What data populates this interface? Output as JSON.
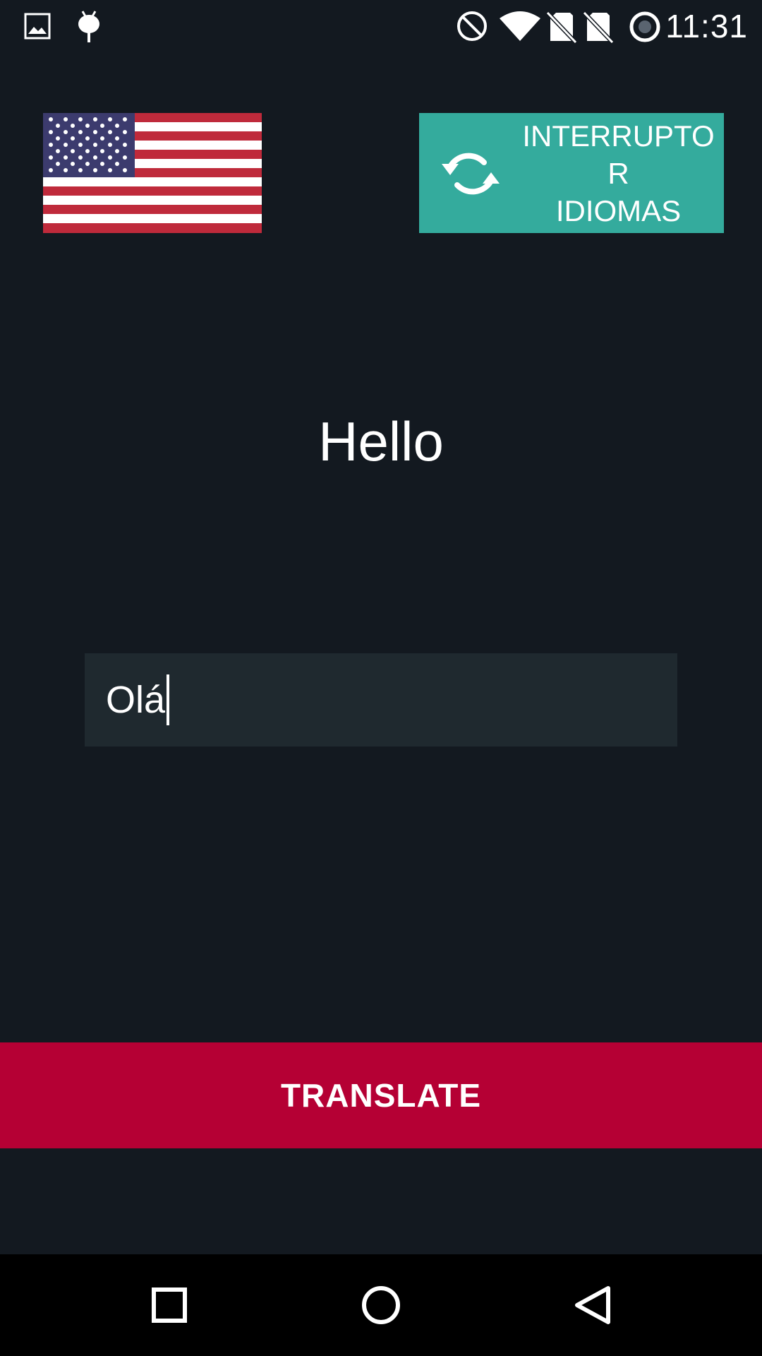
{
  "status_bar": {
    "time": "11:31",
    "icons": [
      "image-icon",
      "android-debug-icon",
      "do-not-disturb-icon",
      "wifi-icon",
      "no-sim-icon",
      "no-sim-icon",
      "battery-icon"
    ]
  },
  "language": {
    "flag": "us-flag-icon",
    "switch_label": "INTERRUPTO\nR\nIDIOMAS",
    "switch_icon": "swap-icon"
  },
  "translation": {
    "source_text": "Hello",
    "input_value": "Olá",
    "button_label": "TRANSLATE"
  },
  "nav_bar": {
    "icons": [
      "recents-icon",
      "home-icon",
      "back-icon"
    ]
  },
  "colors": {
    "background": "#131920",
    "switch_button": "#34ab9d",
    "translate_button": "#b50034",
    "input_background": "#1f292f"
  }
}
